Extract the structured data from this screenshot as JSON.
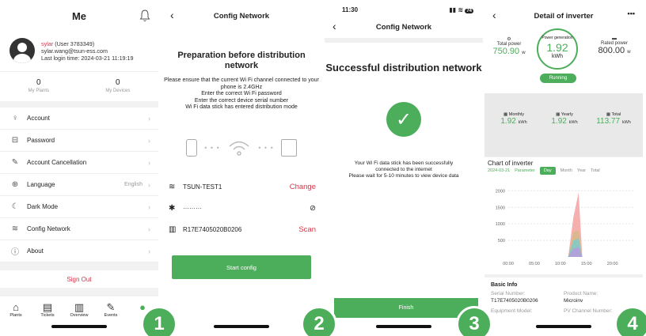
{
  "p1": {
    "title": "Me",
    "user_name": "sylar",
    "user_id": "(User 3783349)",
    "email": "sylar.wang@tsun-ess.com",
    "last_login_label": "Last login time:",
    "last_login": "2024-03-21 11:19:19",
    "stats": [
      {
        "value": "0",
        "label": "My Plants"
      },
      {
        "value": "0",
        "label": "My Devices"
      }
    ],
    "menu": [
      {
        "label": "Account",
        "icon": "user-icon",
        "glyph": "♀"
      },
      {
        "label": "Password",
        "icon": "lock-icon",
        "glyph": "⊟"
      },
      {
        "label": "Account Cancellation",
        "icon": "wrench-icon",
        "glyph": "✎"
      },
      {
        "label": "Language",
        "icon": "globe-icon",
        "glyph": "⊕",
        "value": "English"
      },
      {
        "label": "Dark Mode",
        "icon": "moon-icon",
        "glyph": "☾"
      },
      {
        "label": "Config Network",
        "icon": "wifi-config-icon",
        "glyph": "≋"
      },
      {
        "label": "About",
        "icon": "info-icon",
        "glyph": "ⓘ"
      }
    ],
    "sign_out": "Sign Out",
    "tabs": [
      {
        "label": "Plants",
        "glyph": "⌂",
        "icon": "home-icon"
      },
      {
        "label": "Tickets",
        "glyph": "▤",
        "icon": "ticket-icon"
      },
      {
        "label": "Overview",
        "glyph": "▥",
        "icon": "chart-icon"
      },
      {
        "label": "Events",
        "glyph": "✎",
        "icon": "events-icon"
      },
      {
        "label": "",
        "glyph": "●",
        "icon": "profile-icon"
      }
    ],
    "step": "1"
  },
  "p2": {
    "title": "Config Network",
    "heading": "Preparation before distribution network",
    "instructions": [
      "Please ensure that the current Wi Fi channel connected to your phone is 2.4GHz",
      "Enter the correct Wi Fi password",
      "Enter the correct device serial number",
      "Wi Fi data stick has entered distribution mode"
    ],
    "ssid": "TSUN-TEST1",
    "ssid_action": "Change",
    "password_mask": "·········",
    "serial": "R17E7405020B0206",
    "serial_action": "Scan",
    "button": "Start config",
    "step": "2"
  },
  "p3": {
    "time": "11:30",
    "battery": "74",
    "title": "Config Network",
    "heading": "Successful distribution network",
    "message_lines": [
      "Your Wi Fi data stick has been successfully",
      "connected to the internet",
      "Please wait for 5-10 minutes to view device data"
    ],
    "button": "Finish",
    "step": "3"
  },
  "p4": {
    "title": "Detail of inverter",
    "total_power_label": "Total power",
    "total_power": "750.90",
    "total_power_unit": "w",
    "gen_label": "Power generation",
    "gen_value": "1.92",
    "gen_unit": "kWh",
    "rated_label": "Rated power",
    "rated_value": "800.00",
    "rated_unit": "w",
    "status": "Running",
    "energy": [
      {
        "label": "Monthly",
        "value": "1.92",
        "unit": "kWh"
      },
      {
        "label": "Yearly",
        "value": "1.92",
        "unit": "kWh"
      },
      {
        "label": "Total",
        "value": "113.77",
        "unit": "kWh"
      }
    ],
    "chart_title": "Chart of inverter",
    "chart_date": "2024-03-21",
    "chart_param": "Parameter",
    "periods": [
      "Day",
      "Month",
      "Year",
      "Total"
    ],
    "basic_title": "Basic Info",
    "serial_label": "Serial Number:",
    "serial_value": "T17E7405020B0206",
    "product_label": "Product Name:",
    "product_value": "Microinv",
    "model_label": "Equipment Model:",
    "channel_label": "PV Channel Number:",
    "step": "4"
  },
  "chart_data": {
    "type": "area",
    "x_ticks": [
      "00:00",
      "05:00",
      "10:00",
      "15:00",
      "20:00"
    ],
    "y_ticks": [
      500,
      1000,
      1500,
      2000
    ],
    "ylim": [
      0,
      2200
    ],
    "xlim": [
      0,
      24
    ],
    "series": [
      {
        "name": "",
        "color": "#b39ddb",
        "x": [
          11.5,
          12.5,
          13.5,
          14.2
        ],
        "values": [
          0,
          250,
          300,
          0
        ]
      },
      {
        "name": "",
        "color": "#80cbc4",
        "x": [
          11.5,
          12.5,
          13.5,
          14.2
        ],
        "values": [
          0,
          500,
          550,
          0
        ]
      },
      {
        "name": "",
        "color": "#d7b98a",
        "x": [
          11.5,
          12.5,
          13.5,
          14.2
        ],
        "values": [
          0,
          750,
          800,
          0
        ]
      },
      {
        "name": "",
        "color": "#f4a6a6",
        "x": [
          11.5,
          12.5,
          13.5,
          14.2
        ],
        "values": [
          0,
          1200,
          1950,
          0
        ]
      }
    ]
  }
}
